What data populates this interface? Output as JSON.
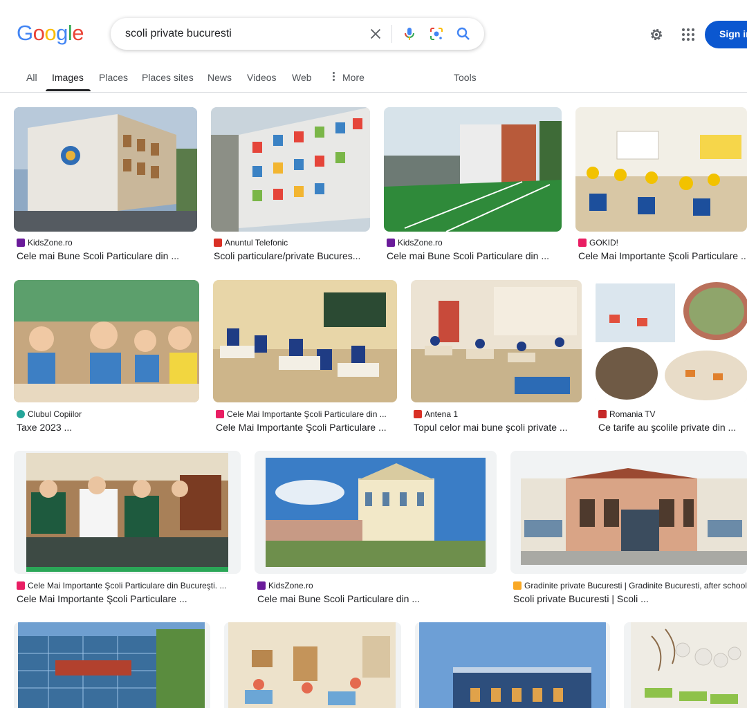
{
  "logo": {
    "letters": [
      "G",
      "o",
      "o",
      "g",
      "l",
      "e"
    ],
    "colors": [
      "#4285F4",
      "#EA4335",
      "#FBBC05",
      "#4285F4",
      "#34A853",
      "#EA4335"
    ]
  },
  "search": {
    "query": "scoli private bucuresti"
  },
  "header": {
    "sign_in": "Sign in"
  },
  "tabs": [
    "All",
    "Images",
    "Places",
    "Places sites",
    "News",
    "Videos",
    "Web",
    "More",
    "Tools"
  ],
  "active_tab": "Images",
  "results": [
    {
      "source": "KidsZone.ro",
      "caption": "Cele mai Bune Scoli Particulare din ...",
      "favicon_color": "#6a1b9a"
    },
    {
      "source": "Anuntul Telefonic",
      "caption": "Scoli particulare/private Bucures...",
      "favicon_color": "#d93025"
    },
    {
      "source": "KidsZone.ro",
      "caption": "Cele mai Bune Scoli Particulare din ...",
      "favicon_color": "#6a1b9a"
    },
    {
      "source": "GOKID!",
      "caption": "Cele Mai Importante Şcoli Particulare ...",
      "favicon_color": "#e91e63"
    },
    {
      "source": "Clubul Copiilor",
      "caption": "Taxe 2023 ...",
      "favicon_color": "#26a69a"
    },
    {
      "source": "Cele Mai Importante Şcoli Particulare din ...",
      "caption": "Cele Mai Importante Şcoli Particulare ...",
      "favicon_color": "#e91e63"
    },
    {
      "source": "Antena 1",
      "caption": "Topul celor mai bune şcoli private ...",
      "favicon_color": "#d93025"
    },
    {
      "source": "Romania TV",
      "caption": "Ce tarife au şcolile private din ...",
      "favicon_color": "#c62828"
    },
    {
      "source": "Cele Mai Importante Şcoli Particulare din Bucureşti. ...",
      "caption": "Cele Mai Importante Şcoli Particulare ...",
      "favicon_color": "#e91e63"
    },
    {
      "source": "KidsZone.ro",
      "caption": "Cele mai Bune Scoli Particulare din ...",
      "favicon_color": "#6a1b9a"
    },
    {
      "source": "Gradinite private Bucuresti | Gradinite Bucuresti, after school",
      "caption": "Scoli private Bucuresti | Scoli ...",
      "favicon_color": "#f9a825"
    },
    {
      "source": "",
      "caption": "",
      "favicon_color": ""
    },
    {
      "source": "",
      "caption": "",
      "favicon_color": ""
    },
    {
      "source": "",
      "caption": "",
      "favicon_color": ""
    },
    {
      "source": "",
      "caption": "",
      "favicon_color": ""
    }
  ]
}
